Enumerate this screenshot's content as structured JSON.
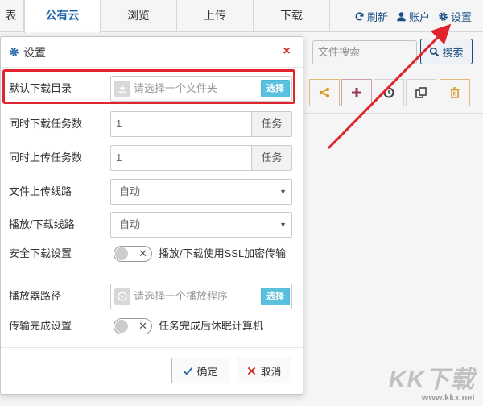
{
  "tabs": [
    {
      "label": "表"
    },
    {
      "label": "公有云"
    },
    {
      "label": "浏览"
    },
    {
      "label": "上传"
    },
    {
      "label": "下载"
    }
  ],
  "top_actions": {
    "refresh": "刷新",
    "account": "账户",
    "settings": "设置"
  },
  "search": {
    "placeholder": "文件搜索",
    "button": "搜索"
  },
  "dialog": {
    "title": "设置",
    "close": "×",
    "rows": {
      "download_dir": {
        "label": "默认下载目录",
        "placeholder": "请选择一个文件夹",
        "button": "选择"
      },
      "concurrent_download": {
        "label": "同时下载任务数",
        "value": "1",
        "suffix": "任务"
      },
      "concurrent_upload": {
        "label": "同时上传任务数",
        "value": "1",
        "suffix": "任务"
      },
      "upload_route": {
        "label": "文件上传线路",
        "value": "自动"
      },
      "playback_route": {
        "label": "播放/下载线路",
        "value": "自动"
      },
      "secure_download": {
        "label": "安全下载设置",
        "description": "播放/下载使用SSL加密传输"
      },
      "player_path": {
        "label": "播放器路径",
        "placeholder": "请选择一个播放程序",
        "button": "选择"
      },
      "on_complete": {
        "label": "传输完成设置",
        "description": "任务完成后休眠计算机"
      }
    },
    "ok": "确定",
    "cancel": "取消"
  },
  "watermark": {
    "brand": "KK下载",
    "url": "www.kkx.net"
  },
  "colors": {
    "accent": "#1a4f86",
    "active_tab": "#1a5fa8",
    "highlight": "#e0232d",
    "pick_button": "#5bc0de"
  }
}
